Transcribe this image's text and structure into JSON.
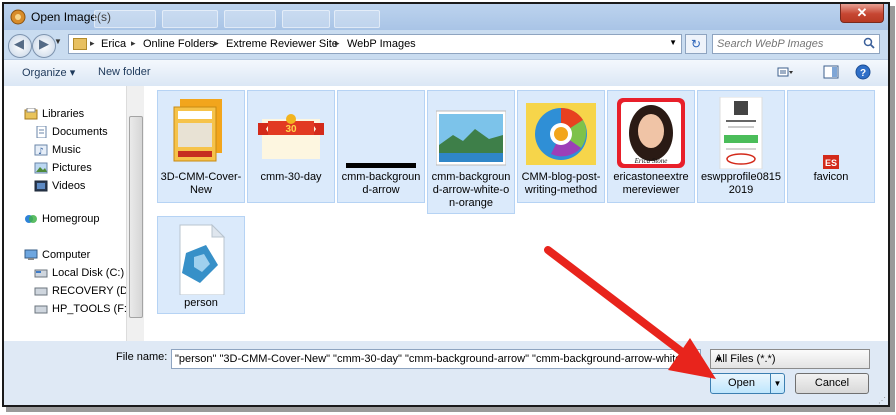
{
  "window": {
    "title": "Open Image(s)",
    "close_glyph": "✕"
  },
  "nav": {
    "back_glyph": "◀",
    "forward_glyph": "▶",
    "breadcrumb": [
      "Erica",
      "Online Folders",
      "Extreme Reviewer Site",
      "WebP Images"
    ],
    "refresh_glyph": "↻",
    "search_placeholder": "Search WebP Images"
  },
  "toolbar": {
    "organize_label": "Organize ▾",
    "new_folder_label": "New folder"
  },
  "sidebar": {
    "libraries": "Libraries",
    "library_items": [
      "Documents",
      "Music",
      "Pictures",
      "Videos"
    ],
    "homegroup": "Homegroup",
    "computer": "Computer",
    "drives": [
      "Local Disk (C:)",
      "RECOVERY (D:)",
      "HP_TOOLS (F:)"
    ]
  },
  "files": [
    {
      "name": "3D-CMM-Cover-New",
      "icon": "ebook-cover-thumbnail"
    },
    {
      "name": "cmm-30-day",
      "icon": "ribbon-banner-thumbnail"
    },
    {
      "name": "cmm-background-arrow",
      "icon": "black-bar-thumbnail"
    },
    {
      "name": "cmm-background-arrow-white-on-orange",
      "icon": "landscape-photo-thumbnail"
    },
    {
      "name": "CMM-blog-post-writing-method",
      "icon": "colorful-infographic-thumbnail"
    },
    {
      "name": "ericastoneextremereviewer",
      "icon": "portrait-photo-thumbnail"
    },
    {
      "name": "eswpprofile08152019",
      "icon": "profile-page-thumbnail"
    },
    {
      "name": "favicon",
      "icon": "es-favicon-thumbnail"
    },
    {
      "name": "person",
      "icon": "generic-image-file-icon"
    }
  ],
  "thumb_text": {
    "ribbon": "30",
    "portrait_signature": "Erica Stone",
    "favicon": "ES"
  },
  "footer": {
    "file_name_label": "File name:",
    "file_name_value": "\"person\" \"3D-CMM-Cover-New\" \"cmm-30-day\" \"cmm-background-arrow\" \"cmm-background-arrow-white-on-orange\"",
    "filter_value": "All Files (*.*)",
    "open_label": "Open",
    "cancel_label": "Cancel"
  },
  "colors": {
    "selection": "#dbeafb",
    "annotation_arrow": "#e8241c",
    "frame": "#c9dcf0"
  }
}
